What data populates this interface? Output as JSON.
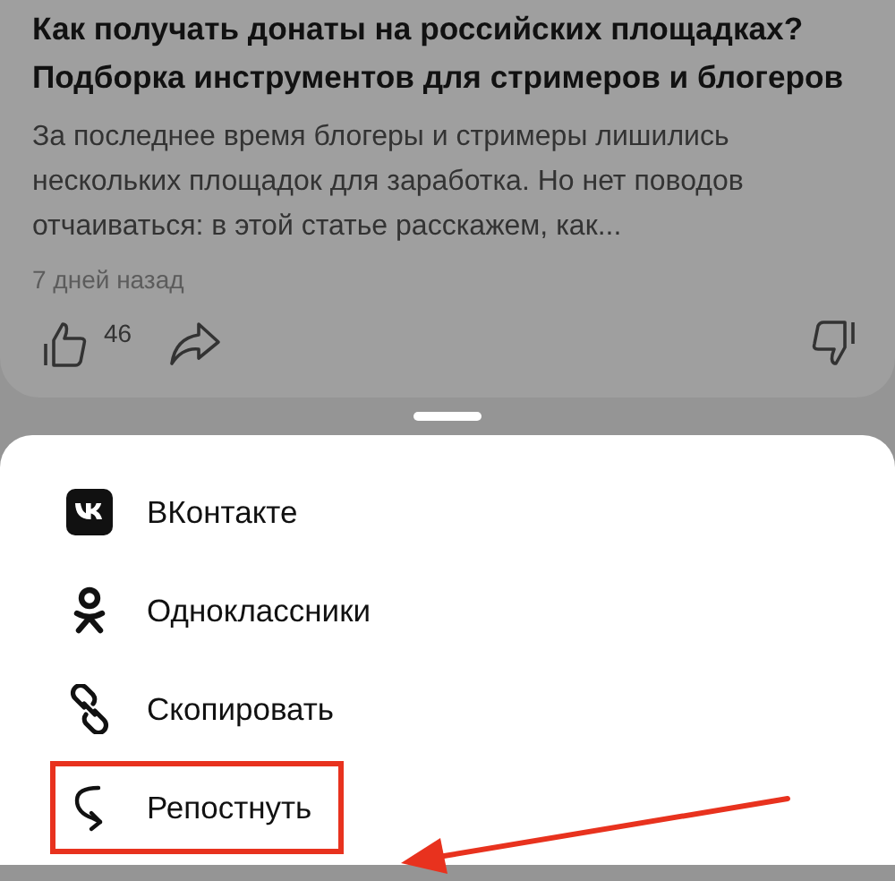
{
  "article": {
    "title": "Как получать донаты на российских площадках? Подборка инструментов для стримеров и блогеров",
    "description": "За последнее время блогеры и стримеры лишились нескольких площадок для заработка. Но нет поводов отчаиваться: в этой статье расскажем, как...",
    "date": "7 дней назад",
    "likes": "46"
  },
  "share_options": [
    {
      "kind": "vk",
      "label": "ВКонтакте",
      "highlighted": false
    },
    {
      "kind": "ok",
      "label": "Одноклассники",
      "highlighted": false
    },
    {
      "kind": "copy",
      "label": "Скопировать",
      "highlighted": false
    },
    {
      "kind": "repost",
      "label": "Репостнуть",
      "highlighted": true
    }
  ]
}
